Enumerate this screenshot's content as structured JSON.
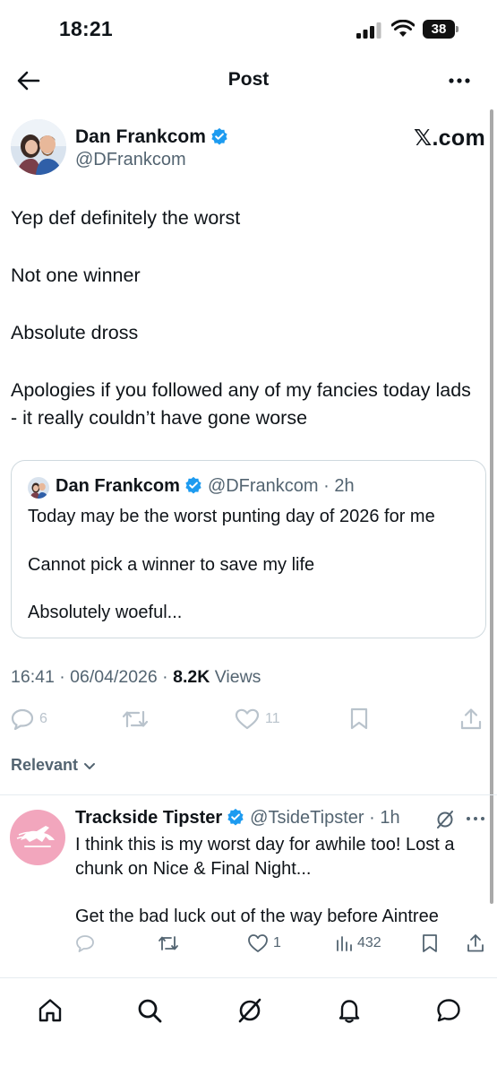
{
  "status_bar": {
    "time": "18:21",
    "battery": "38"
  },
  "topbar": {
    "title": "Post"
  },
  "post": {
    "author_name": "Dan Frankcom",
    "author_handle": "@DFrankcom",
    "watermark": "𝕏.com",
    "lines": [
      "Yep def definitely the worst",
      "Not one winner",
      "Absolute dross",
      "Apologies if you followed any of my fancies today lads - it really couldn’t have gone worse"
    ],
    "time": "16:41",
    "date": "06/04/2026",
    "views_count": "8.2K",
    "views_label": "Views",
    "replies": "6",
    "likes": "11"
  },
  "quote": {
    "author_name": "Dan Frankcom",
    "author_handle": "@DFrankcom",
    "age": "2h",
    "lines": [
      "Today may be the worst punting day of 2026 for me",
      "Cannot pick a winner to save my life",
      "Absolutely woeful..."
    ]
  },
  "relevant_label": "Relevant",
  "reply": {
    "author_name": "Trackside Tipster",
    "author_handle": "@TsideTipster",
    "age": "1h",
    "lines": [
      "I think this is my worst day for awhile too! Lost a chunk on Nice & Final Night...",
      "Get the bad luck out of the way before Aintree"
    ],
    "likes": "1",
    "views": "432"
  },
  "colors": {
    "accent": "#1d9bf0",
    "muted": "#536471",
    "text": "#0f1419"
  }
}
